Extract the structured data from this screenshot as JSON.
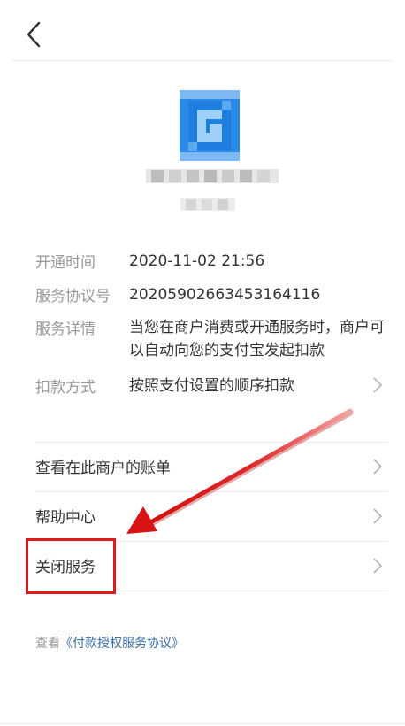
{
  "header": {
    "back_icon": "chevron-left-icon"
  },
  "merchant": {
    "logo_icon": "merchant-logo-blurred",
    "logo_color": "#1e88e5"
  },
  "details": {
    "open_time_label": "开通时间",
    "open_time_value": "2020-11-02 21:56",
    "agreement_no_label": "服务协议号",
    "agreement_no_value": "20205902663453164116",
    "service_detail_label": "服务详情",
    "service_detail_value": "当您在商户消费或开通服务时，商户可以自动向您的支付宝发起扣款",
    "deduct_method_label": "扣款方式",
    "deduct_method_value": "按照支付设置的顺序扣款"
  },
  "menu": {
    "view_bills": "查看在此商户的账单",
    "help_center": "帮助中心",
    "close_service": "关闭服务"
  },
  "footer": {
    "view_prefix": "查看",
    "agreement_link": "《付款授权服务协议》"
  },
  "colors": {
    "highlight": "#e0191f",
    "link": "#3b6ea5",
    "label": "#999999"
  }
}
